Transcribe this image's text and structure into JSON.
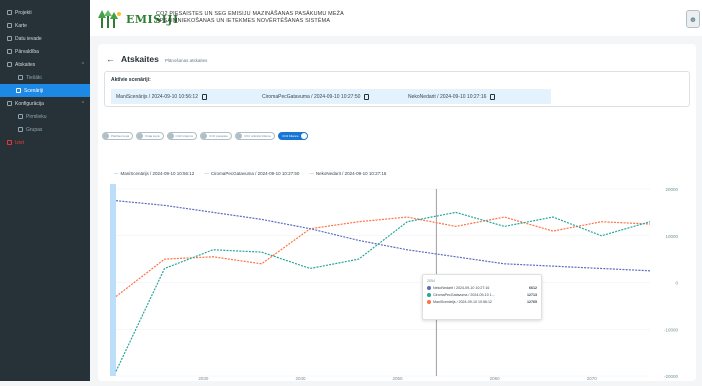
{
  "sidebar": {
    "items": [
      {
        "label": "Projekti",
        "kind": "top"
      },
      {
        "label": "Karte",
        "kind": "top"
      },
      {
        "label": "Datu ievade",
        "kind": "top"
      },
      {
        "label": "Pārvaldība",
        "kind": "top"
      },
      {
        "label": "Atskaites",
        "kind": "group"
      },
      {
        "label": "Tiešāki",
        "kind": "sub2"
      },
      {
        "label": "Scenāriji",
        "kind": "active"
      },
      {
        "label": "Konfigurācija",
        "kind": "group"
      },
      {
        "label": "Pirmlieku",
        "kind": "sub2"
      },
      {
        "label": "Grupas",
        "kind": "sub2"
      },
      {
        "label": "Iziet",
        "kind": "red"
      }
    ]
  },
  "header": {
    "logo_text": "EMISIJI",
    "subtitle_line1": "CO2 PIESAISTES UN SEG EMISIJU MAZINĀŠANAS PASĀKUMU MEŽA",
    "subtitle_line2": "APSAIMNIEKOŠANAS UN IETEKMES NOVĒRTĒŠANAS SISTĒMA"
  },
  "page": {
    "title": "Atskaites",
    "subtitle": "Plānošanas atskaites",
    "active_scenarios_label": "Aktīvie scenāriji:",
    "scenarios": [
      "ManiScenārijs / 2024-09-10 10:56:12",
      "CiromaPecGatavuma / 2024-09-10 10:27:50",
      "NekoNedarit / 2024-09-10 10:27:16"
    ]
  },
  "toggles": [
    {
      "label": "Platības kopā",
      "on": false
    },
    {
      "label": "Krāja kopā",
      "on": false
    },
    {
      "label": "CO2 krājums",
      "on": false
    },
    {
      "label": "CO2 piesaiste",
      "on": false
    },
    {
      "label": "CO2 uzkrātā bilance",
      "on": false
    },
    {
      "label": "CO2 bilance",
      "on": true
    }
  ],
  "colors": {
    "series_blue": "#5c6bc0",
    "series_teal": "#26a69a",
    "series_orange": "#ff7043",
    "active_nav": "#1e88e5",
    "sidebar_bg": "#263238"
  },
  "chart_data": {
    "type": "line",
    "x": [
      2021,
      2026,
      2031,
      2036,
      2041,
      2046,
      2051,
      2056,
      2061,
      2066,
      2071,
      2076
    ],
    "series": [
      {
        "name": "ManiScenārijs / 2024-09-10 10:56:12",
        "values": [
          -3000,
          5000,
          5500,
          4000,
          11500,
          13000,
          14000,
          12000,
          14000,
          11000,
          13000,
          12500
        ]
      },
      {
        "name": "CiromaPecGatavuma / 2024-09-10 10:27:50",
        "values": [
          -19000,
          3000,
          7000,
          6500,
          3000,
          5000,
          13000,
          15000,
          12000,
          14000,
          10000,
          13000
        ]
      },
      {
        "name": "NekoNedarit / 2024-09-10 10:27:16",
        "values": [
          17500,
          16500,
          15000,
          13500,
          11500,
          9000,
          7000,
          5500,
          4000,
          3500,
          3000,
          2500
        ]
      }
    ],
    "ylim": [
      -20000,
      20000
    ],
    "y_ticks": [
      "20000",
      "10000",
      "0",
      "-10000",
      "-20000"
    ],
    "x_ticks": [
      "2030",
      "2040",
      "2050",
      "2060",
      "2070"
    ],
    "tooltip": {
      "date": "2054",
      "rows": [
        {
          "name": "NekoNedarit / 2024-09-10 10:27:16",
          "value": "6612"
        },
        {
          "name": "CiromaPecGatavuma / 2024-09-10 1...",
          "value": "12713"
        },
        {
          "name": "ManiScenārijs / 2024-09-10 10:56:12",
          "value": "12765"
        }
      ]
    }
  }
}
